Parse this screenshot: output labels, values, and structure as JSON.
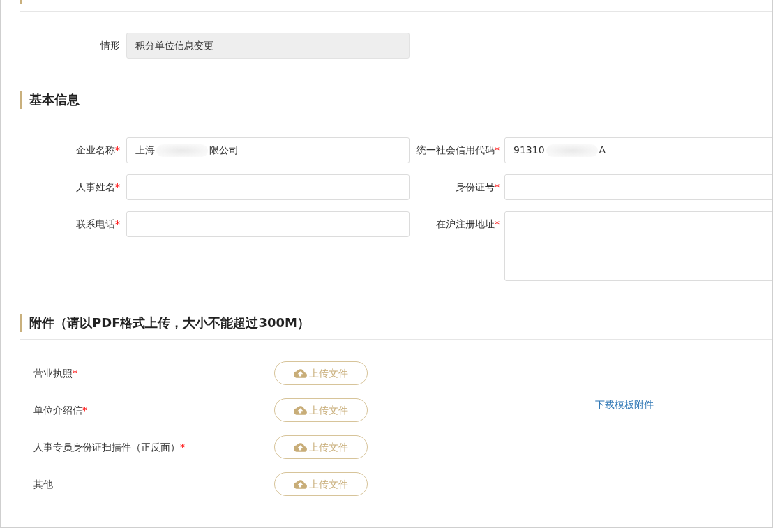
{
  "situation_section": {
    "fields": [
      {
        "label": "情形",
        "kind": "input",
        "value": "积分单位信息变更",
        "disabled": true
      }
    ]
  },
  "basic_info": {
    "title": "基本信息",
    "fields": [
      {
        "label": "企业名称",
        "required_mark": "*",
        "kind": "input",
        "value_parts": [
          "上海",
          "限公司"
        ],
        "disabled": false
      },
      {
        "label": "统一社会信用代码",
        "required_mark": "*",
        "kind": "input",
        "value_parts": [
          "91310",
          "A"
        ],
        "disabled": false
      },
      {
        "label": "人事姓名",
        "required_mark": "*",
        "kind": "input",
        "disabled": false
      },
      {
        "label": "身份证号",
        "required_mark": "*",
        "kind": "input",
        "disabled": false
      },
      {
        "label": "联系电话",
        "required_mark": "*",
        "kind": "input",
        "disabled": false
      },
      {
        "label": "在沪注册地址",
        "required_mark": "*",
        "kind": "textarea",
        "disabled": false
      }
    ]
  },
  "attachments": {
    "title": "附件（请以PDF格式上传，大小不能超过300M）",
    "items": [
      {
        "label": "营业执照",
        "required_mark": "*",
        "button": "上传文件"
      },
      {
        "label": "单位介绍信",
        "required_mark": "*",
        "button": "上传文件"
      },
      {
        "label": "人事专员身份证扫描件（正反面）",
        "required_mark": "*",
        "button": "上传文件"
      },
      {
        "label": "其他",
        "button": "上传文件"
      }
    ],
    "download_link": "下载模板附件"
  }
}
